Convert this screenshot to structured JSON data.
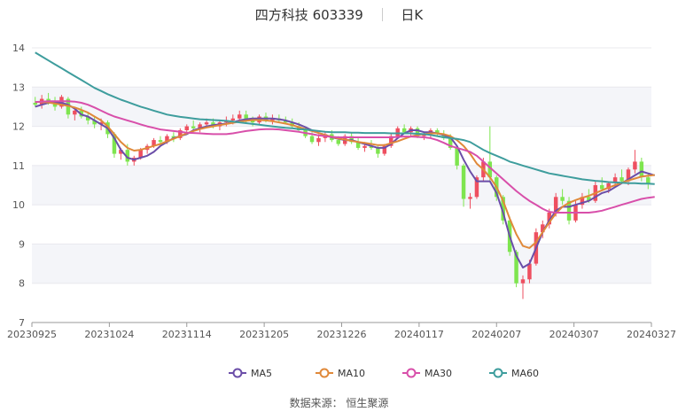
{
  "header": {
    "stock_name": "四方科技",
    "stock_code": "603339",
    "period": "日K"
  },
  "source_text": "数据来源： 恒生聚源",
  "colors": {
    "up": "#ee4f60",
    "down": "#7ee54f",
    "MA5": "#6b4ea8",
    "MA10": "#e0893a",
    "MA30": "#d84faa",
    "MA60": "#3e9d9d",
    "grid": "#e8e8ee",
    "band": "#f4f5f9"
  },
  "chart_data": {
    "type": "candlestick",
    "title": "四方科技 603339 日K",
    "ylim": [
      7,
      14
    ],
    "y_ticks": [
      7,
      8,
      9,
      10,
      11,
      12,
      13,
      14
    ],
    "x_ticks": [
      "20230925",
      "20231024",
      "20231114",
      "20231205",
      "20231226",
      "20240117",
      "20240207",
      "20240307",
      "20240327"
    ],
    "x_tick_index": [
      0,
      20,
      40,
      60,
      80,
      100,
      120,
      140,
      160
    ],
    "legend": [
      "MA5",
      "MA10",
      "MA30",
      "MA60"
    ],
    "legend_position": "bottom",
    "candles": [
      [
        12.6,
        12.75,
        12.5,
        12.55
      ],
      [
        12.55,
        12.8,
        12.45,
        12.7
      ],
      [
        12.7,
        12.85,
        12.55,
        12.6
      ],
      [
        12.6,
        12.75,
        12.4,
        12.5
      ],
      [
        12.5,
        12.8,
        12.45,
        12.75
      ],
      [
        12.7,
        12.75,
        12.2,
        12.3
      ],
      [
        12.3,
        12.45,
        12.15,
        12.4
      ],
      [
        12.4,
        12.5,
        12.2,
        12.25
      ],
      [
        12.25,
        12.35,
        12.05,
        12.15
      ],
      [
        12.15,
        12.25,
        11.95,
        12.05
      ],
      [
        12.05,
        12.2,
        11.9,
        12.1
      ],
      [
        12.1,
        12.15,
        11.7,
        11.8
      ],
      [
        11.8,
        11.85,
        11.2,
        11.3
      ],
      [
        11.3,
        11.45,
        11.15,
        11.4
      ],
      [
        11.4,
        11.55,
        11.0,
        11.1
      ],
      [
        11.1,
        11.25,
        11.0,
        11.2
      ],
      [
        11.2,
        11.45,
        11.15,
        11.4
      ],
      [
        11.4,
        11.55,
        11.3,
        11.5
      ],
      [
        11.5,
        11.7,
        11.45,
        11.65
      ],
      [
        11.65,
        11.75,
        11.5,
        11.6
      ],
      [
        11.6,
        11.8,
        11.55,
        11.75
      ],
      [
        11.75,
        11.85,
        11.6,
        11.7
      ],
      [
        11.7,
        11.95,
        11.65,
        11.9
      ],
      [
        11.9,
        12.05,
        11.8,
        12.0
      ],
      [
        12.0,
        12.15,
        11.85,
        11.95
      ],
      [
        11.95,
        12.1,
        11.85,
        12.05
      ],
      [
        12.05,
        12.2,
        11.95,
        12.1
      ],
      [
        12.1,
        12.2,
        11.95,
        12.0
      ],
      [
        12.0,
        12.15,
        11.9,
        12.1
      ],
      [
        12.1,
        12.25,
        12.0,
        12.15
      ],
      [
        12.15,
        12.3,
        12.05,
        12.2
      ],
      [
        12.2,
        12.4,
        12.1,
        12.3
      ],
      [
        12.3,
        12.4,
        12.1,
        12.15
      ],
      [
        12.15,
        12.25,
        12.0,
        12.1
      ],
      [
        12.1,
        12.3,
        12.05,
        12.25
      ],
      [
        12.25,
        12.35,
        12.1,
        12.15
      ],
      [
        12.15,
        12.3,
        12.05,
        12.2
      ],
      [
        12.2,
        12.3,
        12.1,
        12.15
      ],
      [
        12.15,
        12.25,
        12.05,
        12.1
      ],
      [
        12.1,
        12.2,
        11.95,
        12.0
      ],
      [
        12.0,
        12.1,
        11.85,
        11.9
      ],
      [
        11.9,
        12.0,
        11.7,
        11.75
      ],
      [
        11.75,
        11.85,
        11.55,
        11.6
      ],
      [
        11.6,
        11.8,
        11.5,
        11.7
      ],
      [
        11.7,
        11.85,
        11.6,
        11.8
      ],
      [
        11.8,
        11.9,
        11.6,
        11.65
      ],
      [
        11.65,
        11.75,
        11.5,
        11.55
      ],
      [
        11.55,
        11.8,
        11.5,
        11.75
      ],
      [
        11.75,
        11.85,
        11.55,
        11.6
      ],
      [
        11.6,
        11.7,
        11.4,
        11.45
      ],
      [
        11.45,
        11.6,
        11.35,
        11.5
      ],
      [
        11.5,
        11.65,
        11.4,
        11.45
      ],
      [
        11.45,
        11.5,
        11.2,
        11.3
      ],
      [
        11.3,
        11.55,
        11.25,
        11.5
      ],
      [
        11.5,
        11.8,
        11.45,
        11.75
      ],
      [
        11.75,
        12.0,
        11.7,
        11.95
      ],
      [
        11.95,
        12.05,
        11.8,
        11.85
      ],
      [
        11.85,
        12.0,
        11.75,
        11.95
      ],
      [
        11.95,
        12.0,
        11.7,
        11.75
      ],
      [
        11.75,
        11.85,
        11.65,
        11.8
      ],
      [
        11.8,
        11.95,
        11.7,
        11.9
      ],
      [
        11.9,
        11.95,
        11.75,
        11.8
      ],
      [
        11.8,
        11.9,
        11.65,
        11.7
      ],
      [
        11.7,
        11.8,
        11.4,
        11.45
      ],
      [
        11.45,
        11.5,
        10.9,
        11.0
      ],
      [
        11.0,
        11.05,
        9.95,
        10.15
      ],
      [
        10.15,
        10.3,
        9.9,
        10.2
      ],
      [
        10.2,
        10.75,
        10.15,
        10.7
      ],
      [
        10.7,
        11.2,
        10.6,
        11.1
      ],
      [
        11.1,
        12.0,
        10.6,
        10.7
      ],
      [
        10.7,
        10.75,
        10.1,
        10.2
      ],
      [
        10.2,
        10.25,
        9.5,
        9.6
      ],
      [
        9.6,
        9.7,
        8.7,
        8.8
      ],
      [
        8.8,
        8.85,
        7.9,
        8.0
      ],
      [
        8.0,
        8.2,
        7.6,
        8.1
      ],
      [
        8.1,
        8.6,
        8.0,
        8.5
      ],
      [
        8.5,
        9.4,
        8.45,
        9.3
      ],
      [
        9.3,
        9.6,
        9.15,
        9.5
      ],
      [
        9.5,
        9.9,
        9.4,
        9.8
      ],
      [
        9.8,
        10.3,
        9.7,
        10.2
      ],
      [
        10.2,
        10.4,
        10.0,
        10.1
      ],
      [
        10.1,
        10.2,
        9.5,
        9.6
      ],
      [
        9.6,
        10.1,
        9.55,
        10.0
      ],
      [
        10.0,
        10.3,
        9.9,
        10.2
      ],
      [
        10.2,
        10.4,
        10.05,
        10.1
      ],
      [
        10.1,
        10.6,
        10.05,
        10.5
      ],
      [
        10.5,
        10.7,
        10.35,
        10.4
      ],
      [
        10.4,
        10.6,
        10.3,
        10.55
      ],
      [
        10.55,
        10.8,
        10.45,
        10.7
      ],
      [
        10.7,
        10.9,
        10.55,
        10.6
      ],
      [
        10.6,
        10.95,
        10.5,
        10.9
      ],
      [
        10.9,
        11.4,
        10.8,
        11.1
      ],
      [
        11.1,
        11.2,
        10.6,
        10.7
      ],
      [
        10.7,
        10.8,
        10.4,
        10.55
      ]
    ],
    "series": [
      {
        "name": "MA5",
        "values": [
          12.5,
          12.55,
          12.6,
          12.6,
          12.6,
          12.55,
          12.45,
          12.3,
          12.25,
          12.15,
          12.05,
          11.95,
          11.7,
          11.4,
          11.2,
          11.15,
          11.2,
          11.25,
          11.35,
          11.5,
          11.6,
          11.7,
          11.75,
          11.8,
          11.9,
          11.95,
          12.0,
          12.03,
          12.05,
          12.07,
          12.1,
          12.15,
          12.18,
          12.2,
          12.2,
          12.2,
          12.2,
          12.18,
          12.15,
          12.1,
          12.05,
          11.98,
          11.9,
          11.83,
          11.78,
          11.72,
          11.68,
          11.65,
          11.65,
          11.6,
          11.55,
          11.5,
          11.45,
          11.45,
          11.55,
          11.7,
          11.82,
          11.9,
          11.9,
          11.85,
          11.85,
          11.82,
          11.78,
          11.72,
          11.5,
          11.15,
          10.85,
          10.6,
          10.6,
          10.6,
          10.3,
          9.8,
          9.2,
          8.7,
          8.4,
          8.5,
          8.9,
          9.3,
          9.6,
          9.85,
          9.95,
          9.95,
          10.0,
          10.05,
          10.1,
          10.2,
          10.3,
          10.35,
          10.45,
          10.55,
          10.65,
          10.75,
          10.85,
          10.8,
          10.75
        ]
      },
      {
        "name": "MA10",
        "values": [
          12.62,
          12.62,
          12.61,
          12.58,
          12.55,
          12.52,
          12.48,
          12.42,
          12.35,
          12.25,
          12.15,
          12.0,
          11.8,
          11.6,
          11.45,
          11.38,
          11.4,
          11.45,
          11.5,
          11.55,
          11.62,
          11.68,
          11.75,
          11.82,
          11.88,
          11.93,
          11.97,
          12.0,
          12.03,
          12.06,
          12.09,
          12.12,
          12.14,
          12.16,
          12.16,
          12.15,
          12.13,
          12.1,
          12.07,
          12.03,
          11.98,
          11.93,
          11.88,
          11.83,
          11.78,
          11.73,
          11.69,
          11.66,
          11.63,
          11.6,
          11.58,
          11.55,
          11.52,
          11.52,
          11.57,
          11.62,
          11.68,
          11.74,
          11.78,
          11.8,
          11.82,
          11.82,
          11.8,
          11.75,
          11.65,
          11.5,
          11.3,
          11.05,
          10.9,
          10.7,
          10.45,
          10.1,
          9.65,
          9.25,
          8.95,
          8.9,
          9.05,
          9.3,
          9.55,
          9.78,
          9.95,
          10.05,
          10.12,
          10.18,
          10.23,
          10.3,
          10.37,
          10.44,
          10.5,
          10.56,
          10.62,
          10.67,
          10.72,
          10.74,
          10.76
        ]
      },
      {
        "name": "MA30",
        "values": [
          12.62,
          12.63,
          12.64,
          12.64,
          12.64,
          12.64,
          12.63,
          12.6,
          12.55,
          12.48,
          12.4,
          12.32,
          12.25,
          12.2,
          12.15,
          12.1,
          12.05,
          12.0,
          11.96,
          11.92,
          11.9,
          11.88,
          11.86,
          11.84,
          11.83,
          11.82,
          11.81,
          11.8,
          11.8,
          11.8,
          11.82,
          11.85,
          11.88,
          11.9,
          11.92,
          11.93,
          11.93,
          11.92,
          11.9,
          11.88,
          11.86,
          11.83,
          11.8,
          11.77,
          11.75,
          11.73,
          11.72,
          11.72,
          11.72,
          11.72,
          11.72,
          11.72,
          11.72,
          11.72,
          11.72,
          11.73,
          11.74,
          11.74,
          11.73,
          11.72,
          11.7,
          11.65,
          11.58,
          11.5,
          11.45,
          11.4,
          11.35,
          11.25,
          11.1,
          10.95,
          10.8,
          10.65,
          10.5,
          10.35,
          10.22,
          10.1,
          10.0,
          9.9,
          9.82,
          9.8,
          9.8,
          9.8,
          9.8,
          9.8,
          9.8,
          9.82,
          9.85,
          9.9,
          9.95,
          10.0,
          10.05,
          10.1,
          10.15,
          10.18,
          10.2
        ]
      },
      {
        "name": "MA60",
        "values": [
          13.88,
          13.78,
          13.68,
          13.58,
          13.48,
          13.38,
          13.28,
          13.18,
          13.08,
          12.98,
          12.9,
          12.82,
          12.75,
          12.68,
          12.62,
          12.56,
          12.5,
          12.45,
          12.4,
          12.35,
          12.3,
          12.27,
          12.24,
          12.22,
          12.2,
          12.18,
          12.17,
          12.16,
          12.15,
          12.14,
          12.12,
          12.1,
          12.08,
          12.06,
          12.04,
          12.02,
          12.0,
          11.98,
          11.96,
          11.95,
          11.93,
          11.92,
          11.9,
          11.88,
          11.86,
          11.85,
          11.85,
          11.85,
          11.84,
          11.84,
          11.83,
          11.83,
          11.83,
          11.83,
          11.82,
          11.82,
          11.82,
          11.82,
          11.81,
          11.8,
          11.78,
          11.75,
          11.72,
          11.7,
          11.68,
          11.65,
          11.6,
          11.5,
          11.4,
          11.32,
          11.25,
          11.18,
          11.1,
          11.05,
          11.0,
          10.95,
          10.9,
          10.85,
          10.8,
          10.77,
          10.74,
          10.71,
          10.68,
          10.65,
          10.63,
          10.61,
          10.6,
          10.58,
          10.57,
          10.56,
          10.55,
          10.55,
          10.54,
          10.54,
          10.53
        ]
      }
    ]
  }
}
